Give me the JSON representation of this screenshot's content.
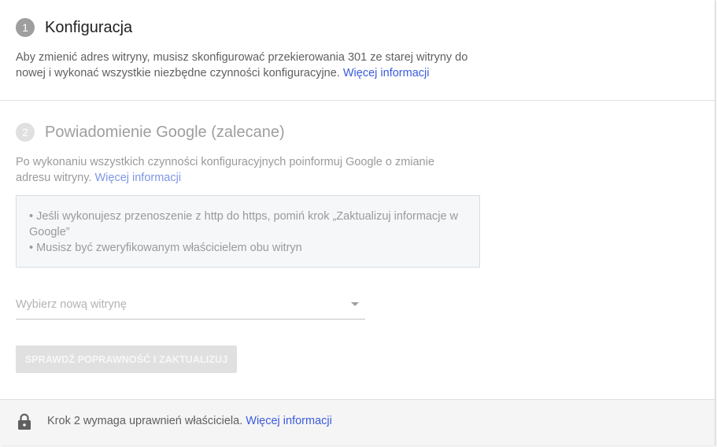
{
  "step1": {
    "number": "1",
    "title": "Konfiguracja",
    "description": "Aby zmienić adres witryny, musisz skonfigurować przekierowania 301 ze starej witryny do nowej i wykonać wszystkie niezbędne czynności konfiguracyjne.",
    "link": "Więcej informacji"
  },
  "step2": {
    "number": "2",
    "title": "Powiadomienie Google (zalecane)",
    "description": "Po wykonaniu wszystkich czynności konfiguracyjnych poinformuj Google o zmianie adresu witryny.",
    "link": "Więcej informacji",
    "notes": [
      "• Jeśli wykonujesz przenoszenie z http do https, pomiń krok „Zaktualizuj informacje w Google”",
      "• Musisz być zweryfikowanym właścicielem obu witryn"
    ],
    "select_placeholder": "Wybierz nową witrynę",
    "button_label": "SPRAWDŹ POPRAWNOŚĆ I ZAKTUALIZUJ"
  },
  "footer": {
    "text": "Krok 2 wymaga uprawnień właściciela.",
    "link": "Więcej informacji",
    "icon": "lock-icon"
  },
  "colors": {
    "link": "#3b5bdb",
    "step1_circle": "#9e9e9e",
    "step2_circle": "#e0e0e0"
  }
}
